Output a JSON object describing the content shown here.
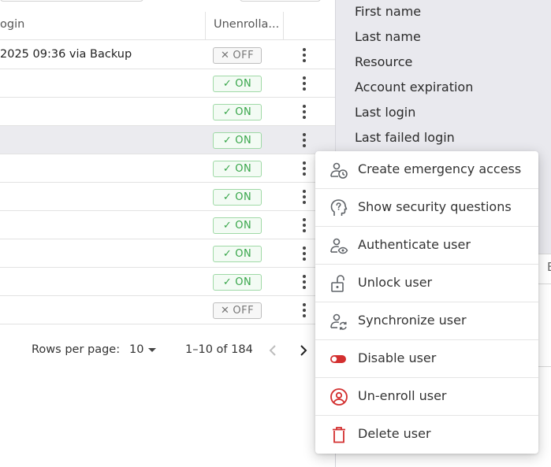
{
  "table": {
    "header": {
      "login_col": "ogin",
      "unenroll_col": "Unenrolla..."
    },
    "rows": [
      {
        "login": "2025 09:36 via Backup",
        "unenrollable": "OFF",
        "state": "off"
      },
      {
        "login": "",
        "unenrollable": "ON",
        "state": "on"
      },
      {
        "login": "",
        "unenrollable": "ON",
        "state": "on"
      },
      {
        "login": "",
        "unenrollable": "ON",
        "state": "on"
      },
      {
        "login": "",
        "unenrollable": "ON",
        "state": "on"
      },
      {
        "login": "",
        "unenrollable": "ON",
        "state": "on"
      },
      {
        "login": "",
        "unenrollable": "ON",
        "state": "on"
      },
      {
        "login": "",
        "unenrollable": "ON",
        "state": "on"
      },
      {
        "login": "",
        "unenrollable": "ON",
        "state": "on"
      },
      {
        "login": "",
        "unenrollable": "OFF",
        "state": "off"
      }
    ]
  },
  "pagination": {
    "rows_per_page_label": "Rows per page:",
    "rows_per_page_value": "10",
    "range": "1–10 of 184"
  },
  "column_panel": {
    "items": [
      "First name",
      "Last name",
      "Resource",
      "Account expiration",
      "Last login",
      "Last failed login"
    ],
    "edge_letter": "E"
  },
  "context_menu": {
    "items": [
      {
        "label": "Create emergency access",
        "icon": "user-clock-icon"
      },
      {
        "label": "Show security questions",
        "icon": "question-head-icon"
      },
      {
        "label": "Authenticate user",
        "icon": "user-eye-icon"
      },
      {
        "label": "Unlock user",
        "icon": "unlock-icon"
      },
      {
        "label": "Synchronize user",
        "icon": "user-sync-icon"
      },
      {
        "label": "Disable user",
        "icon": "toggle-off-icon"
      },
      {
        "label": "Un-enroll user",
        "icon": "user-circle-remove-icon"
      },
      {
        "label": "Delete user",
        "icon": "trash-icon"
      }
    ]
  },
  "colors": {
    "on_green": "#38a64a",
    "danger_red": "#d32f2f",
    "icon_gray": "#5f6368",
    "panel_bg": "#e9e9ee",
    "row_highlight": "#ebebef"
  }
}
